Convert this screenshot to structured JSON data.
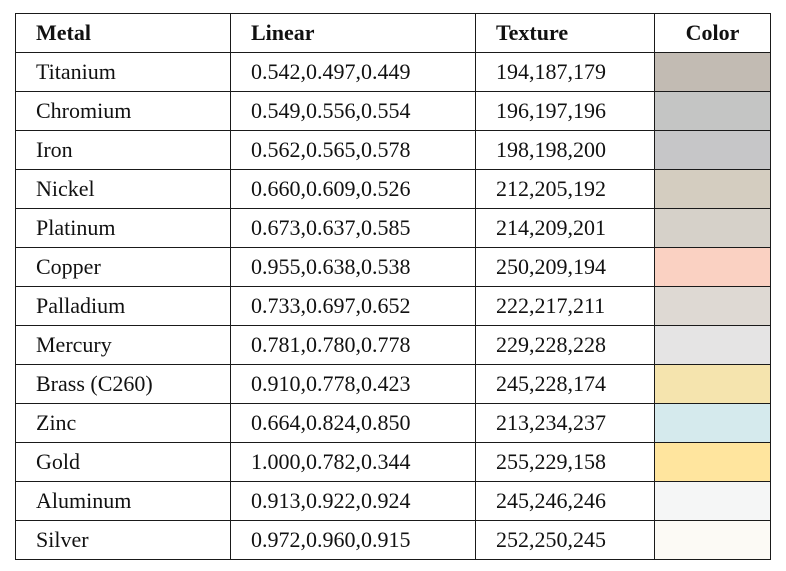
{
  "table": {
    "headers": {
      "metal": "Metal",
      "linear": "Linear",
      "texture": "Texture",
      "color": "Color"
    },
    "rows": [
      {
        "metal": "Titanium",
        "linear": "0.542,0.497,0.449",
        "texture": "194,187,179",
        "color": "#c2bbb3"
      },
      {
        "metal": "Chromium",
        "linear": "0.549,0.556,0.554",
        "texture": "196,197,196",
        "color": "#c4c5c4"
      },
      {
        "metal": "Iron",
        "linear": "0.562,0.565,0.578",
        "texture": "198,198,200",
        "color": "#c6c6c8"
      },
      {
        "metal": "Nickel",
        "linear": "0.660,0.609,0.526",
        "texture": "212,205,192",
        "color": "#d4cdc0"
      },
      {
        "metal": "Platinum",
        "linear": "0.673,0.637,0.585",
        "texture": "214,209,201",
        "color": "#d6d1c9"
      },
      {
        "metal": "Copper",
        "linear": "0.955,0.638,0.538",
        "texture": "250,209,194",
        "color": "#fad1c2"
      },
      {
        "metal": "Palladium",
        "linear": "0.733,0.697,0.652",
        "texture": "222,217,211",
        "color": "#ded9d3"
      },
      {
        "metal": "Mercury",
        "linear": "0.781,0.780,0.778",
        "texture": "229,228,228",
        "color": "#e5e4e4"
      },
      {
        "metal": "Brass (C260)",
        "linear": "0.910,0.778,0.423",
        "texture": "245,228,174",
        "color": "#f5e4ae"
      },
      {
        "metal": "Zinc",
        "linear": "0.664,0.824,0.850",
        "texture": "213,234,237",
        "color": "#d5eaed"
      },
      {
        "metal": "Gold",
        "linear": "1.000,0.782,0.344",
        "texture": "255,229,158",
        "color": "#ffe59e"
      },
      {
        "metal": "Aluminum",
        "linear": "0.913,0.922,0.924",
        "texture": "245,246,246",
        "color": "#f5f6f6"
      },
      {
        "metal": "Silver",
        "linear": "0.972,0.960,0.915",
        "texture": "252,250,245",
        "color": "#fcfaf5"
      }
    ]
  }
}
